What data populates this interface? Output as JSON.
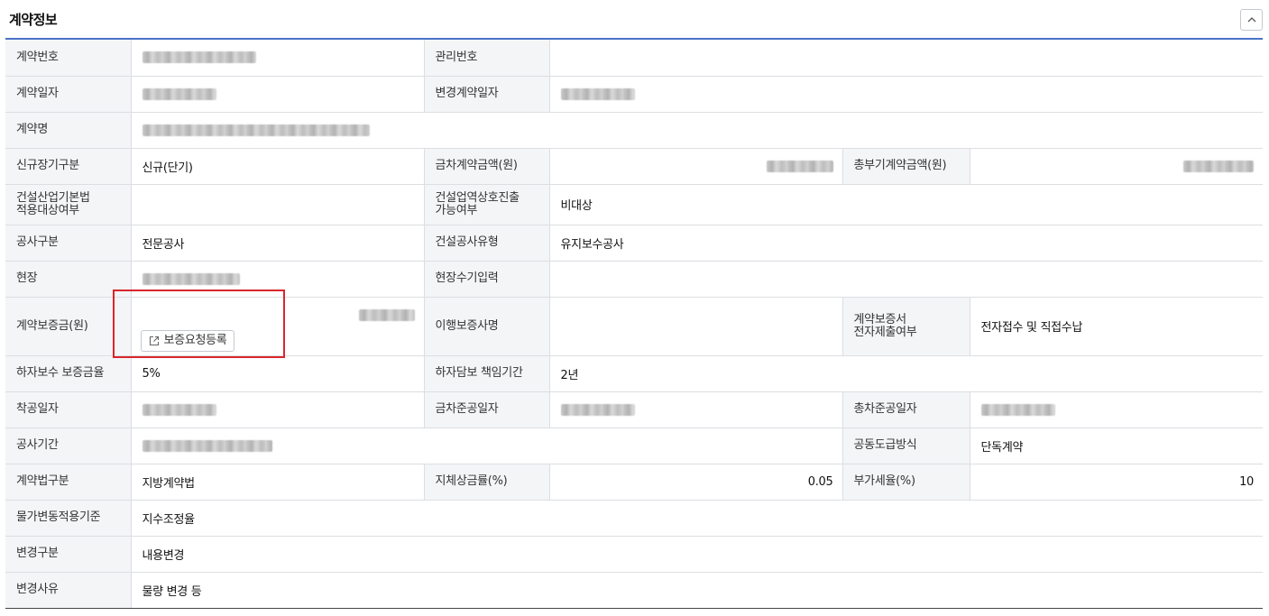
{
  "title": "계약정보",
  "collapse_icon": "chevron-up-icon",
  "colors": {
    "header_line": "#4a72c8",
    "label_bg": "#f4f5f7",
    "highlight": "#d9262c"
  },
  "labels": {
    "contract_no": "계약번호",
    "management_no": "관리번호",
    "contract_date": "계약일자",
    "changed_contract_date": "변경계약일자",
    "contract_name": "계약명",
    "new_long_term": "신규장기구분",
    "current_amount": "금차계약금액(원)",
    "total_amount": "총부기계약금액(원)",
    "construction_act_line1": "건설산업기본법",
    "construction_act_line2": "적용대상여부",
    "mutual_entry_line1": "건설업역상호진출",
    "mutual_entry_line2": "가능여부",
    "work_category": "공사구분",
    "work_type": "건설공사유형",
    "site": "현장",
    "site_manual_input": "현장수기입력",
    "contract_bond": "계약보증금(원)",
    "surety_company": "이행보증사명",
    "bond_submit_line1": "계약보증서",
    "bond_submit_line2": "전자제출여부",
    "defect_bond_rate": "하자보수 보증금율",
    "defect_liability_period": "하자담보 책임기간",
    "start_date": "착공일자",
    "current_completion_date": "금차준공일자",
    "total_completion_date": "총차준공일자",
    "work_period": "공사기간",
    "joint_contract_method": "공동도급방식",
    "contract_law_type": "계약법구분",
    "delay_penalty_rate": "지체상금률(%)",
    "vat_rate": "부가세율(%)",
    "price_adjustment_basis": "물가변동적용기준",
    "change_type": "변경구분",
    "change_reason": "변경사유"
  },
  "values": {
    "new_long_term": "신규(단기)",
    "mutual_entry": "비대상",
    "work_category": "전문공사",
    "work_type": "유지보수공사",
    "bond_submit": "전자접수 및 직접수납",
    "defect_bond_rate": "5%",
    "defect_liability_period": "2년",
    "joint_contract_method": "단독계약",
    "contract_law_type": "지방계약법",
    "delay_penalty_rate": "0.05",
    "vat_rate": "10",
    "price_adjustment_basis": "지수조정율",
    "change_type": "내용변경",
    "change_reason": "물량 변경 등"
  },
  "bond_request_button": {
    "label": "보증요청등록",
    "icon": "external-link-icon"
  }
}
